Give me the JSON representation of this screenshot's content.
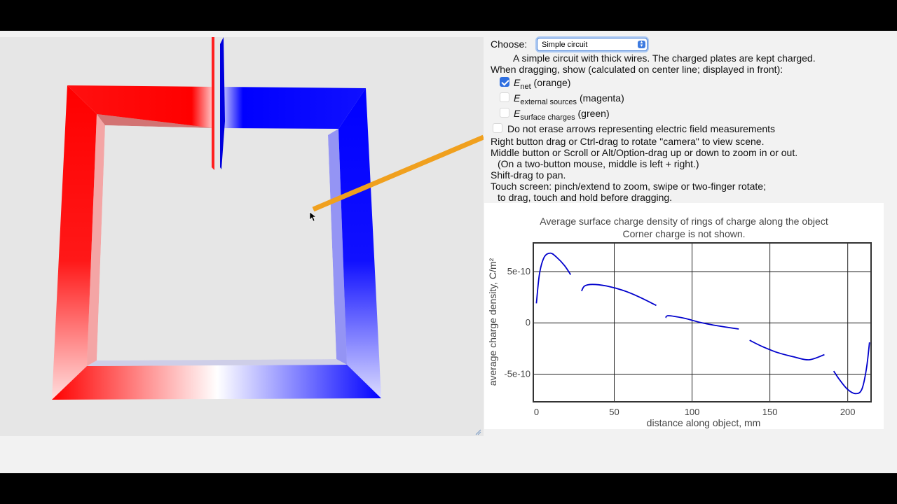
{
  "controls": {
    "choose_label": "Choose:",
    "circuit_select": "Simple circuit",
    "description": "A simple circuit with thick wires. The charged plates are kept charged.",
    "dragging_label": "When dragging, show (calculated on center line; displayed in front):",
    "options": [
      {
        "symbol": "E",
        "sub": "net",
        "suffix": " (orange)",
        "checked": true
      },
      {
        "symbol": "E",
        "sub": "external sources",
        "suffix": " (magenta)",
        "checked": false
      },
      {
        "symbol": "E",
        "sub": "surface charges",
        "suffix": " (green)",
        "checked": false
      }
    ],
    "no_erase_label": "Do not erase arrows representing electric field measurements",
    "no_erase_checked": false
  },
  "instructions": [
    "Right button drag or Ctrl-drag to rotate \"camera\" to view scene.",
    "Middle button or Scroll or Alt/Option-drag up or down to zoom in or out.",
    "  (On a two-button mouse, middle is left + right.)",
    "Shift-drag to pan.",
    "Touch screen: pinch/extend to zoom, swipe or two-finger rotate;",
    "  to drag, touch and hold before dragging."
  ],
  "colors": {
    "positive_charge": "#ff0000",
    "negative_charge": "#0000ff",
    "e_net_arrow": "#f0a01e",
    "curve": "#0000cc"
  },
  "chart_data": {
    "type": "line",
    "title": "Average surface charge density of rings of charge along the object",
    "subtitle": "Corner charge is not shown.",
    "xlabel": "distance along object, mm",
    "ylabel": "average charge density, C/m²",
    "xlim": [
      -2,
      215
    ],
    "ylim": [
      -7.7e-10,
      7.8e-10
    ],
    "x_ticks": [
      0,
      50,
      100,
      150,
      200
    ],
    "x_tick_labels": [
      "0",
      "50",
      "100",
      "150",
      "200"
    ],
    "y_ticks": [
      5e-10,
      0,
      -5e-10
    ],
    "y_tick_labels": [
      "5e-10",
      "0",
      "-5e-10"
    ],
    "grid": true,
    "series": [
      {
        "x": [
          0,
          2,
          5,
          9,
          13,
          18,
          22
        ],
        "y": [
          1.9e-10,
          4.8e-10,
          6.4e-10,
          6.8e-10,
          6.4e-10,
          5.6e-10,
          4.7e-10
        ]
      },
      {
        "x": [
          29,
          31,
          36,
          45,
          55,
          65,
          77
        ],
        "y": [
          3.1e-10,
          3.6e-10,
          3.75e-10,
          3.6e-10,
          3.2e-10,
          2.6e-10,
          1.7e-10
        ]
      },
      {
        "x": [
          83,
          85,
          95,
          105,
          115,
          130
        ],
        "y": [
          5e-11,
          7e-11,
          4.5e-11,
          5e-12,
          -2.5e-11,
          -6e-11
        ]
      },
      {
        "x": [
          137,
          145,
          155,
          165,
          175,
          185
        ],
        "y": [
          -1.7e-10,
          -2.3e-10,
          -2.9e-10,
          -3.3e-10,
          -3.6e-10,
          -3.1e-10
        ]
      },
      {
        "x": [
          191,
          195,
          200,
          205,
          209,
          212,
          214
        ],
        "y": [
          -4.7e-10,
          -5.6e-10,
          -6.5e-10,
          -6.9e-10,
          -6.5e-10,
          -4.5e-10,
          -1.9e-10
        ]
      }
    ]
  }
}
